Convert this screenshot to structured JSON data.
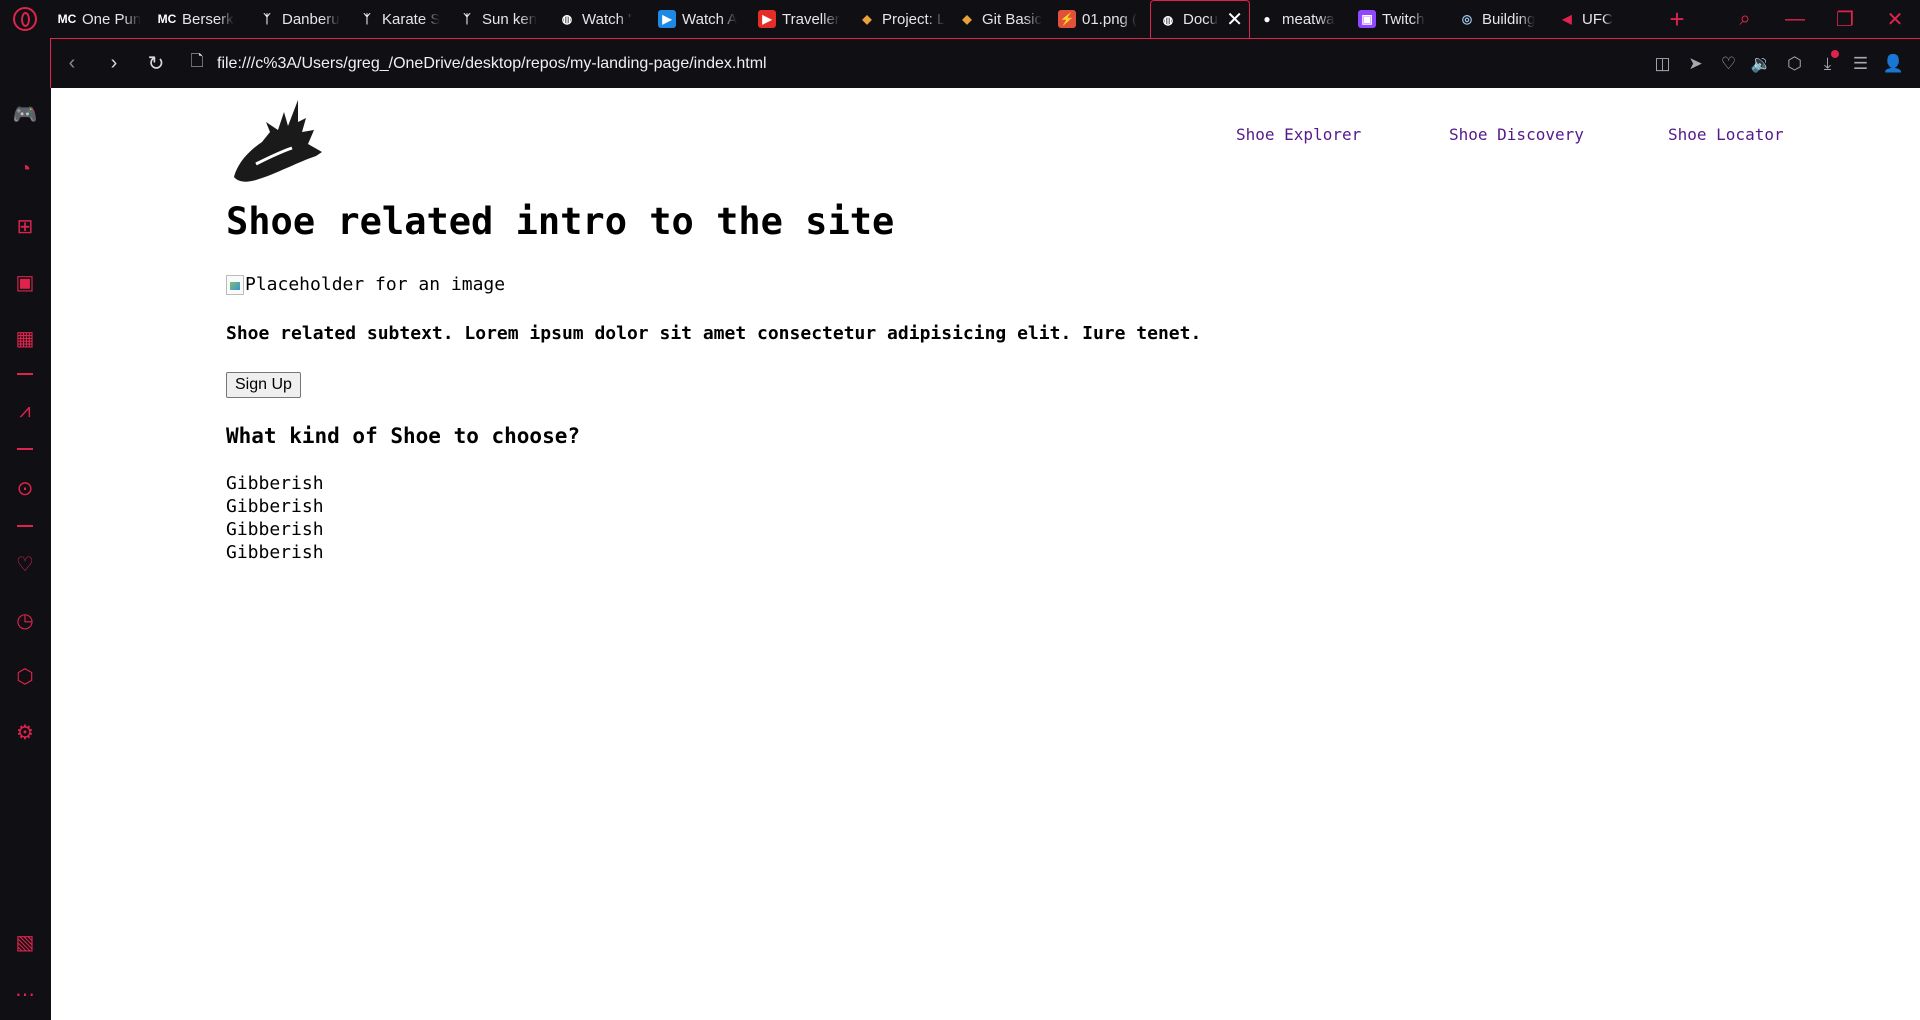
{
  "browser": {
    "tabs": [
      {
        "label": "One Pun",
        "favicon": "MC",
        "favicon_color": "#ffffff",
        "favicon_bg": "transparent"
      },
      {
        "label": "Berserk",
        "favicon": "MC",
        "favicon_color": "#ffffff",
        "favicon_bg": "transparent"
      },
      {
        "label": "Danberu",
        "favicon": "ᛉ",
        "favicon_color": "#ffffff",
        "favicon_bg": "transparent"
      },
      {
        "label": "Karate S",
        "favicon": "ᛉ",
        "favicon_color": "#ffffff",
        "favicon_bg": "transparent"
      },
      {
        "label": "Sun ken",
        "favicon": "ᛉ",
        "favicon_color": "#ffffff",
        "favicon_bg": "transparent"
      },
      {
        "label": "Watch \"",
        "favicon": "◍",
        "favicon_color": "#ffffff",
        "favicon_bg": "transparent"
      },
      {
        "label": "Watch A",
        "favicon": "▶",
        "favicon_color": "#ffffff",
        "favicon_bg": "#1e88e5"
      },
      {
        "label": "Traveller",
        "favicon": "▶",
        "favicon_color": "#ffffff",
        "favicon_bg": "#e52d27"
      },
      {
        "label": "Project: L",
        "favicon": "◆",
        "favicon_color": "#e9a23b",
        "favicon_bg": "transparent"
      },
      {
        "label": "Git Basic",
        "favicon": "◆",
        "favicon_color": "#e9a23b",
        "favicon_bg": "transparent"
      },
      {
        "label": "01.png (",
        "favicon": "⚡",
        "favicon_color": "#ffffff",
        "favicon_bg": "#e0503a"
      },
      {
        "label": "Docu",
        "favicon": "◍",
        "favicon_color": "#ffffff",
        "favicon_bg": "transparent",
        "active": true
      },
      {
        "label": "meatwa",
        "favicon": "●",
        "favicon_color": "#ffffff",
        "favicon_bg": "transparent"
      },
      {
        "label": "Twitch",
        "favicon": "▣",
        "favicon_color": "#ffffff",
        "favicon_bg": "#9146ff"
      },
      {
        "label": "Building",
        "favicon": "◎",
        "favicon_color": "#9ec3e6",
        "favicon_bg": "transparent"
      },
      {
        "label": "UFC",
        "favicon": "◀",
        "favicon_color": "#e0234e",
        "favicon_bg": "transparent"
      }
    ],
    "new_tab_label": "+",
    "url": "file:///c%3A/Users/greg_/OneDrive/desktop/repos/my-landing-page/index.html",
    "accent_color": "#e0234e"
  },
  "page": {
    "nav": [
      "Shoe Explorer",
      "Shoe Discovery",
      "Shoe Locator"
    ],
    "title": "Shoe related intro to the site",
    "image_alt": "Placeholder for an image",
    "subtext": "Shoe related subtext. Lorem ipsum dolor sit amet consectetur adipisicing elit. Iure tenet.",
    "signup_label": "Sign Up",
    "section_title": "What kind of Shoe to choose?",
    "list": [
      "Gibberish",
      "Gibberish",
      "Gibberish",
      "Gibberish"
    ],
    "link_color": "#551a8b"
  }
}
